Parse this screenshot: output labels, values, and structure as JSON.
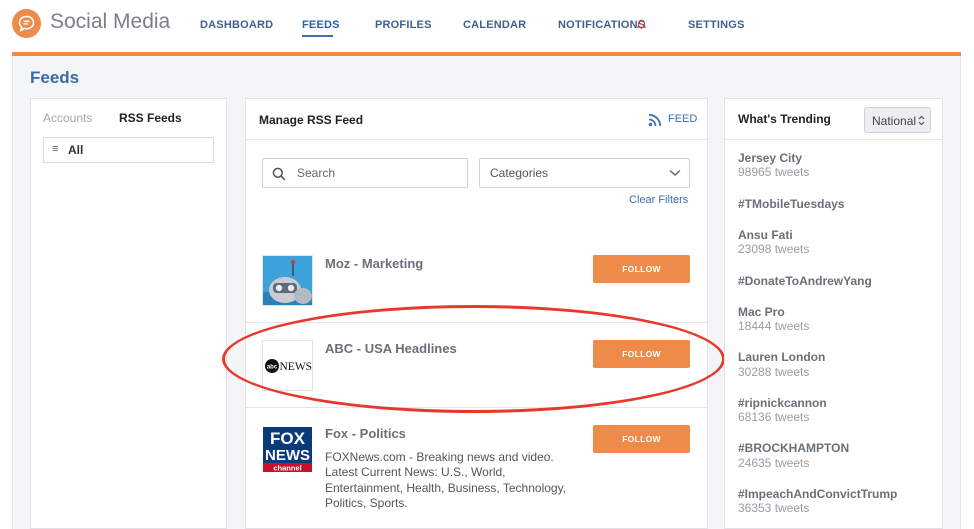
{
  "app": {
    "title": "Social Media"
  },
  "nav": {
    "items": [
      {
        "label": "DASHBOARD"
      },
      {
        "label": "FEEDS"
      },
      {
        "label": "PROFILES"
      },
      {
        "label": "CALENDAR"
      },
      {
        "label": "NOTIFICATIONS"
      },
      {
        "label": "SETTINGS"
      }
    ],
    "active": "FEEDS"
  },
  "page": {
    "title": "Feeds"
  },
  "left_panel": {
    "tabs": [
      {
        "label": "Accounts"
      },
      {
        "label": "RSS Feeds"
      }
    ],
    "active_tab": "RSS Feeds",
    "list": [
      {
        "label": "All"
      }
    ]
  },
  "center": {
    "title": "Manage RSS Feed",
    "feed_link": "FEED",
    "search": {
      "placeholder": "Search",
      "value": ""
    },
    "categories": {
      "selected": "Categories"
    },
    "clear_filters": "Clear Filters",
    "feeds": [
      {
        "name": "Moz - Marketing",
        "button": "FOLLOW",
        "description": ""
      },
      {
        "name": "ABC - USA Headlines",
        "button": "FOLLOW",
        "description": ""
      },
      {
        "name": "Fox - Politics",
        "button": "FOLLOW",
        "description": "FOXNews.com - Breaking news and video. Latest Current News: U.S., World, Entertainment, Health, Business, Technology, Politics, Sports."
      }
    ],
    "logos": {
      "abc": "NEWS",
      "fox_line1": "FOX",
      "fox_line2": "NEWS",
      "fox_line3": "channel"
    }
  },
  "right": {
    "title": "What's Trending",
    "region": "National",
    "trends": [
      {
        "name": "Jersey City",
        "count": "98965 tweets"
      },
      {
        "name": "#TMobileTuesdays",
        "count": ""
      },
      {
        "name": "Ansu Fati",
        "count": "23098 tweets"
      },
      {
        "name": "#DonateToAndrewYang",
        "count": ""
      },
      {
        "name": "Mac Pro",
        "count": "18444 tweets"
      },
      {
        "name": "Lauren London",
        "count": "30288 tweets"
      },
      {
        "name": "#ripnickcannon",
        "count": "68136 tweets"
      },
      {
        "name": "#BROCKHAMPTON",
        "count": "24635 tweets"
      },
      {
        "name": "#ImpeachAndConvictTrump",
        "count": "36353 tweets"
      }
    ]
  },
  "colors": {
    "accent": "#ee8a4a",
    "link": "#3f6fb5",
    "annotation": "#e8382c"
  }
}
